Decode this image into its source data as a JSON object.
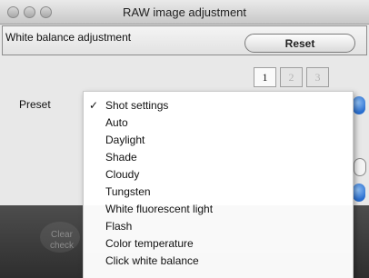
{
  "window": {
    "title": "RAW image adjustment"
  },
  "group": {
    "label": "White balance adjustment",
    "reset_label": "Reset"
  },
  "tabs": [
    {
      "label": "1",
      "active": true
    },
    {
      "label": "2",
      "active": false
    },
    {
      "label": "3",
      "active": false
    }
  ],
  "preset": {
    "label": "Preset",
    "selected": "Shot settings"
  },
  "menu": {
    "check_glyph": "✓",
    "items": [
      "Shot settings",
      "Auto",
      "Daylight",
      "Shade",
      "Cloudy",
      "Tungsten",
      "White fluorescent light",
      "Flash",
      "Color temperature",
      "Click white balance"
    ]
  },
  "bottom": {
    "clear_check_label": "Clear\ncheck"
  },
  "colors": {
    "accent_blue": "#2a6fd0",
    "dark_band": "#3a3a3a"
  }
}
